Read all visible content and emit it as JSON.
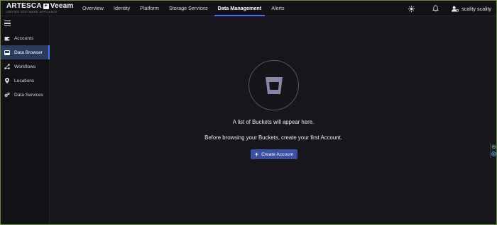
{
  "brand": {
    "name": "ARTESCA",
    "plus": "+",
    "partner": "Veeam",
    "tagline": "UNIFIED SOFTWARE APPLIANCE"
  },
  "nav": {
    "items": [
      {
        "label": "Overview"
      },
      {
        "label": "Identity"
      },
      {
        "label": "Platform"
      },
      {
        "label": "Storage Services"
      },
      {
        "label": "Data Management"
      },
      {
        "label": "Alerts"
      }
    ],
    "active": "Data Management"
  },
  "toolbar": {
    "theme_icon": "sun-icon",
    "notifications_icon": "bell-icon",
    "user_icon": "user-gear-icon",
    "user_name": "scality scality"
  },
  "sidebar": {
    "menu_icon": "hamburger-icon",
    "items": [
      {
        "label": "Accounts",
        "icon": "wallet-icon"
      },
      {
        "label": "Data Browser",
        "icon": "browser-icon"
      },
      {
        "label": "Workflows",
        "icon": "workflow-icon"
      },
      {
        "label": "Locations",
        "icon": "map-pin-icon"
      },
      {
        "label": "Data Services",
        "icon": "cogs-icon"
      }
    ],
    "active": "Data Browser"
  },
  "main": {
    "empty_icon": "bucket-icon",
    "message_primary": "A list of Buckets will appear here.",
    "message_secondary": "Before browsing your Buckets, create your first Account.",
    "create_button_label": "Create Account",
    "create_button_icon": "plus-icon"
  },
  "colors": {
    "background": "#16161c",
    "bar": "#121217",
    "accent": "#4c6ef5",
    "button": "#3d4fa3",
    "active_item": "#2a3b5c",
    "outer_border": "#6a8f3a"
  }
}
